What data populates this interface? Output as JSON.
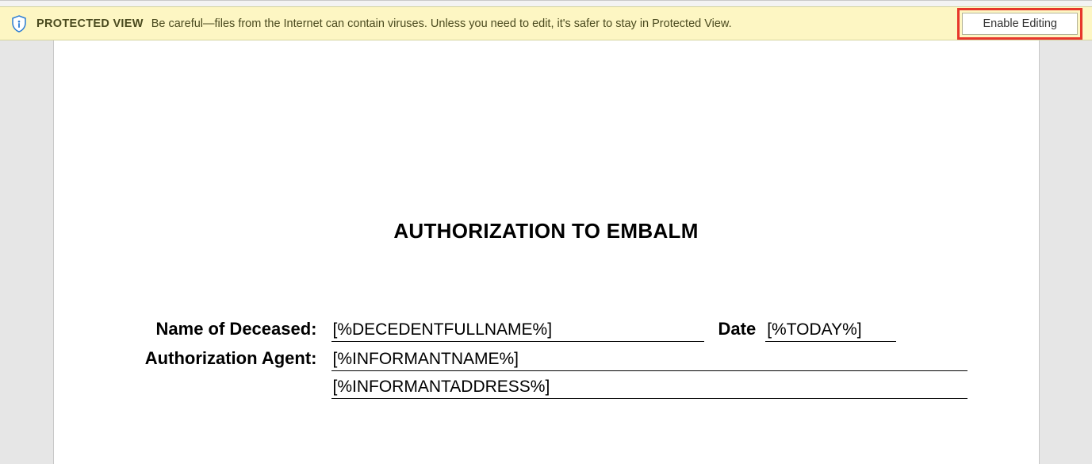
{
  "protectedView": {
    "label": "PROTECTED VIEW",
    "message": "Be careful—files from the Internet can contain viruses. Unless you need to edit, it's safer to stay in Protected View.",
    "buttonLabel": "Enable Editing"
  },
  "document": {
    "title": "AUTHORIZATION TO EMBALM",
    "fields": {
      "nameOfDeceasedLabel": "Name of Deceased:",
      "nameOfDeceasedValue": "[%DECEDENTFULLNAME%]",
      "dateLabel": "Date",
      "dateValue": "[%TODAY%]",
      "authAgentLabel": "Authorization Agent:",
      "authAgentValue": "[%INFORMANTNAME%]",
      "authAgentAddress": "[%INFORMANTADDRESS%]"
    }
  }
}
